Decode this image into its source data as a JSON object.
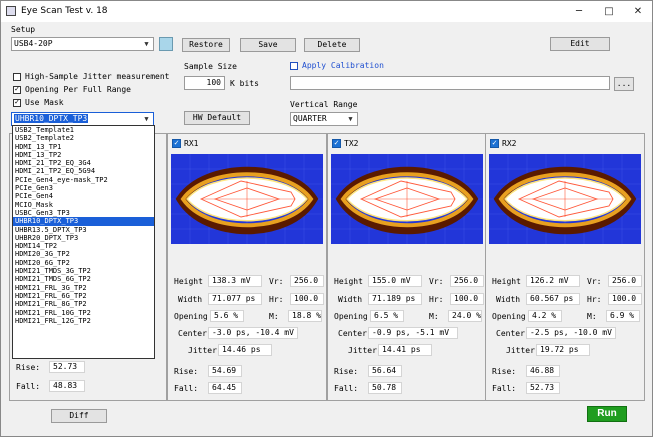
{
  "window": {
    "title": "Eye Scan Test v. 18",
    "minimize": "─",
    "maximize": "□",
    "close": "✕"
  },
  "setup": {
    "label": "Setup",
    "preset_value": "USB4-20P",
    "restore": "Restore",
    "save": "Save",
    "delete": "Delete",
    "edit": "Edit"
  },
  "options": {
    "high_sample": "High-Sample Jitter measurement",
    "opening_full_range": "Opening Per Full Range",
    "use_mask": "Use Mask",
    "mask_value": "UHBR10_DPTX_TP3",
    "hw_default": "HW Default"
  },
  "sample": {
    "label": "Sample Size",
    "value": "100",
    "unit": "K bits"
  },
  "calibration": {
    "label": "Apply Calibration",
    "path": "",
    "browse": "..."
  },
  "vertical": {
    "label": "Vertical Range",
    "value": "QUARTER"
  },
  "mask_options": [
    "USB2_Template1",
    "USB2_Template2",
    "HDMI_13_TP1",
    "HDMI_13_TP2",
    "HDMI_21_TP2_EQ_3G4",
    "HDMI_21_TP2_EQ_5G94",
    "PCIe_Gen4_eye-mask_TP2",
    "PCIe_Gen3",
    "PCIe_Gen4",
    "MCIO_Mask",
    "USBC_Gen3_TP3",
    "UHBR10_DPTX_TP3",
    "UHBR13.5_DPTX_TP3",
    "UHBR20_DPTX_TP3",
    "HDMI14_TP2",
    "HDMI20_3G_TP2",
    "HDMI20_6G_TP2",
    "HDMI21_TMDS_3G_TP2",
    "HDMI21_TMDS_6G_TP2",
    "HDMI21_FRL_3G_TP2",
    "HDMI21_FRL_6G_TP2",
    "HDMI21_FRL_8G_TP2",
    "HDMI21_FRL_10G_TP2",
    "HDMI21_FRL_12G_TP2"
  ],
  "selected_mask_index": 11,
  "labels": {
    "height": "Height",
    "width": "Width",
    "opening": "Opening",
    "center": "Center",
    "jitter": "Jitter",
    "rise": "Rise:",
    "fall": "Fall:",
    "vr": "Vr:",
    "hr": "Hr:",
    "m": "M:"
  },
  "panel0": {
    "rise": "52.73",
    "fall": "48.83"
  },
  "lanes": [
    {
      "name": "RX1",
      "height": "138.3 mV",
      "vr": "256.0",
      "width": "71.077 ps",
      "hr": "100.0",
      "opening": "5.6 %",
      "m": "18.8 %",
      "center": "-3.0 ps, -10.4 mV",
      "jitter": "14.46 ps",
      "rise": "54.69",
      "fall": "64.45"
    },
    {
      "name": "TX2",
      "height": "155.0 mV",
      "vr": "256.0",
      "width": "71.189 ps",
      "hr": "100.0",
      "opening": "6.5 %",
      "m": "24.0 %",
      "center": "-0.9 ps, -5.1 mV",
      "jitter": "14.41 ps",
      "rise": "56.64",
      "fall": "50.78"
    },
    {
      "name": "RX2",
      "height": "126.2 mV",
      "vr": "256.0",
      "width": "60.567 ps",
      "hr": "100.0",
      "opening": "4.2 %",
      "m": "6.9 %",
      "center": "-2.5 ps, -10.0 mV",
      "jitter": "19.72 ps",
      "rise": "46.88",
      "fall": "52.73"
    }
  ],
  "colors": {
    "eye_bg": "#2236d9",
    "accent": "#1a5fd8",
    "run": "#1f9d1f",
    "mask": "#ff5a3c"
  },
  "footer": {
    "diff": "Diff",
    "run": "Run"
  }
}
